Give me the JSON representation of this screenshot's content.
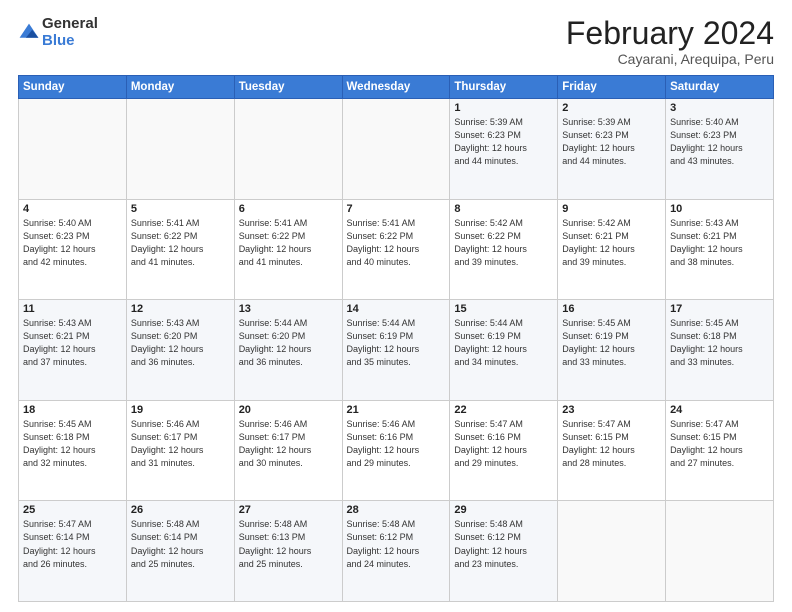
{
  "logo": {
    "general": "General",
    "blue": "Blue"
  },
  "header": {
    "month_year": "February 2024",
    "location": "Cayarani, Arequipa, Peru"
  },
  "weekdays": [
    "Sunday",
    "Monday",
    "Tuesday",
    "Wednesday",
    "Thursday",
    "Friday",
    "Saturday"
  ],
  "weeks": [
    [
      {
        "day": "",
        "info": ""
      },
      {
        "day": "",
        "info": ""
      },
      {
        "day": "",
        "info": ""
      },
      {
        "day": "",
        "info": ""
      },
      {
        "day": "1",
        "info": "Sunrise: 5:39 AM\nSunset: 6:23 PM\nDaylight: 12 hours\nand 44 minutes."
      },
      {
        "day": "2",
        "info": "Sunrise: 5:39 AM\nSunset: 6:23 PM\nDaylight: 12 hours\nand 44 minutes."
      },
      {
        "day": "3",
        "info": "Sunrise: 5:40 AM\nSunset: 6:23 PM\nDaylight: 12 hours\nand 43 minutes."
      }
    ],
    [
      {
        "day": "4",
        "info": "Sunrise: 5:40 AM\nSunset: 6:23 PM\nDaylight: 12 hours\nand 42 minutes."
      },
      {
        "day": "5",
        "info": "Sunrise: 5:41 AM\nSunset: 6:22 PM\nDaylight: 12 hours\nand 41 minutes."
      },
      {
        "day": "6",
        "info": "Sunrise: 5:41 AM\nSunset: 6:22 PM\nDaylight: 12 hours\nand 41 minutes."
      },
      {
        "day": "7",
        "info": "Sunrise: 5:41 AM\nSunset: 6:22 PM\nDaylight: 12 hours\nand 40 minutes."
      },
      {
        "day": "8",
        "info": "Sunrise: 5:42 AM\nSunset: 6:22 PM\nDaylight: 12 hours\nand 39 minutes."
      },
      {
        "day": "9",
        "info": "Sunrise: 5:42 AM\nSunset: 6:21 PM\nDaylight: 12 hours\nand 39 minutes."
      },
      {
        "day": "10",
        "info": "Sunrise: 5:43 AM\nSunset: 6:21 PM\nDaylight: 12 hours\nand 38 minutes."
      }
    ],
    [
      {
        "day": "11",
        "info": "Sunrise: 5:43 AM\nSunset: 6:21 PM\nDaylight: 12 hours\nand 37 minutes."
      },
      {
        "day": "12",
        "info": "Sunrise: 5:43 AM\nSunset: 6:20 PM\nDaylight: 12 hours\nand 36 minutes."
      },
      {
        "day": "13",
        "info": "Sunrise: 5:44 AM\nSunset: 6:20 PM\nDaylight: 12 hours\nand 36 minutes."
      },
      {
        "day": "14",
        "info": "Sunrise: 5:44 AM\nSunset: 6:19 PM\nDaylight: 12 hours\nand 35 minutes."
      },
      {
        "day": "15",
        "info": "Sunrise: 5:44 AM\nSunset: 6:19 PM\nDaylight: 12 hours\nand 34 minutes."
      },
      {
        "day": "16",
        "info": "Sunrise: 5:45 AM\nSunset: 6:19 PM\nDaylight: 12 hours\nand 33 minutes."
      },
      {
        "day": "17",
        "info": "Sunrise: 5:45 AM\nSunset: 6:18 PM\nDaylight: 12 hours\nand 33 minutes."
      }
    ],
    [
      {
        "day": "18",
        "info": "Sunrise: 5:45 AM\nSunset: 6:18 PM\nDaylight: 12 hours\nand 32 minutes."
      },
      {
        "day": "19",
        "info": "Sunrise: 5:46 AM\nSunset: 6:17 PM\nDaylight: 12 hours\nand 31 minutes."
      },
      {
        "day": "20",
        "info": "Sunrise: 5:46 AM\nSunset: 6:17 PM\nDaylight: 12 hours\nand 30 minutes."
      },
      {
        "day": "21",
        "info": "Sunrise: 5:46 AM\nSunset: 6:16 PM\nDaylight: 12 hours\nand 29 minutes."
      },
      {
        "day": "22",
        "info": "Sunrise: 5:47 AM\nSunset: 6:16 PM\nDaylight: 12 hours\nand 29 minutes."
      },
      {
        "day": "23",
        "info": "Sunrise: 5:47 AM\nSunset: 6:15 PM\nDaylight: 12 hours\nand 28 minutes."
      },
      {
        "day": "24",
        "info": "Sunrise: 5:47 AM\nSunset: 6:15 PM\nDaylight: 12 hours\nand 27 minutes."
      }
    ],
    [
      {
        "day": "25",
        "info": "Sunrise: 5:47 AM\nSunset: 6:14 PM\nDaylight: 12 hours\nand 26 minutes."
      },
      {
        "day": "26",
        "info": "Sunrise: 5:48 AM\nSunset: 6:14 PM\nDaylight: 12 hours\nand 25 minutes."
      },
      {
        "day": "27",
        "info": "Sunrise: 5:48 AM\nSunset: 6:13 PM\nDaylight: 12 hours\nand 25 minutes."
      },
      {
        "day": "28",
        "info": "Sunrise: 5:48 AM\nSunset: 6:12 PM\nDaylight: 12 hours\nand 24 minutes."
      },
      {
        "day": "29",
        "info": "Sunrise: 5:48 AM\nSunset: 6:12 PM\nDaylight: 12 hours\nand 23 minutes."
      },
      {
        "day": "",
        "info": ""
      },
      {
        "day": "",
        "info": ""
      }
    ]
  ]
}
